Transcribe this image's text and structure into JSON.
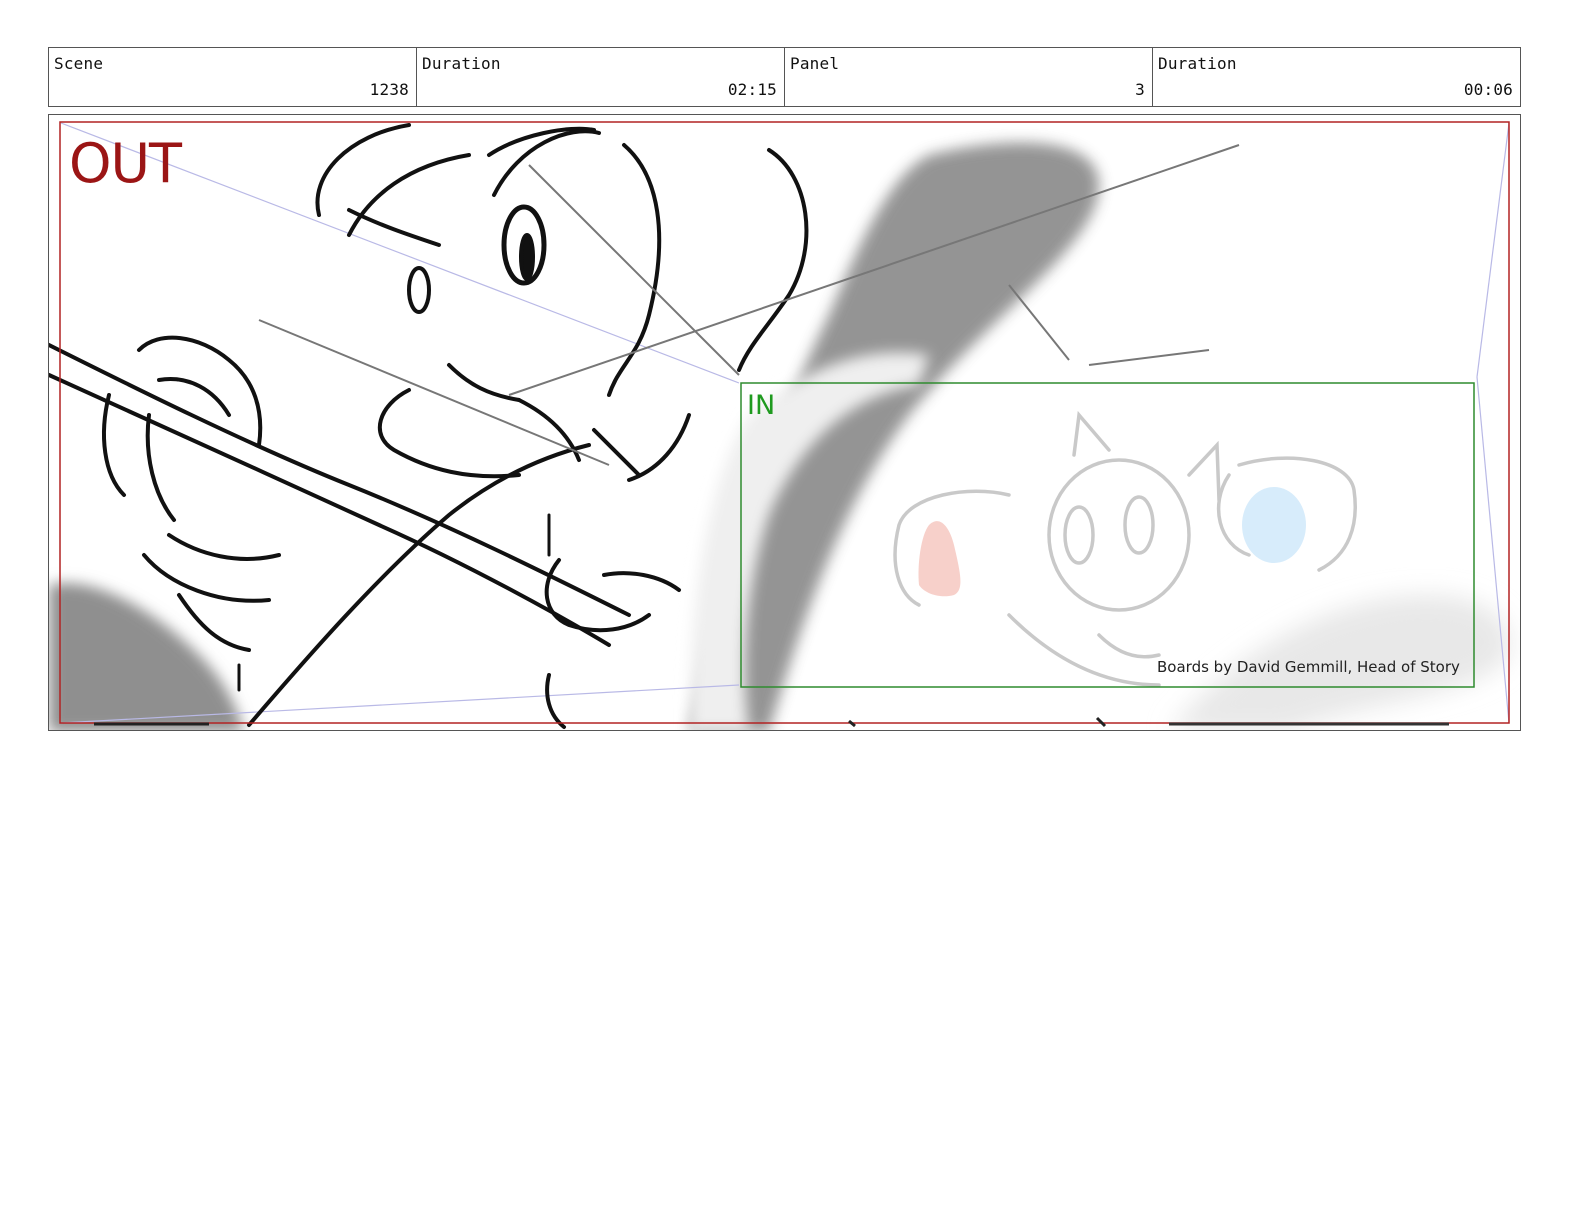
{
  "header": {
    "cells": [
      {
        "label": "Scene",
        "value": "1238"
      },
      {
        "label": "Duration",
        "value": "02:15"
      },
      {
        "label": "Panel",
        "value": "3"
      },
      {
        "label": "Duration",
        "value": "00:06"
      }
    ]
  },
  "panel": {
    "out_label": "OUT",
    "in_label": "IN",
    "credit": "Boards by David Gemmill, Head of Story",
    "colors": {
      "out_frame": "#b22222",
      "in_frame": "#2e8b2e",
      "blur_shape": "#999999",
      "perspective_lines": "#b9b9e6"
    }
  }
}
